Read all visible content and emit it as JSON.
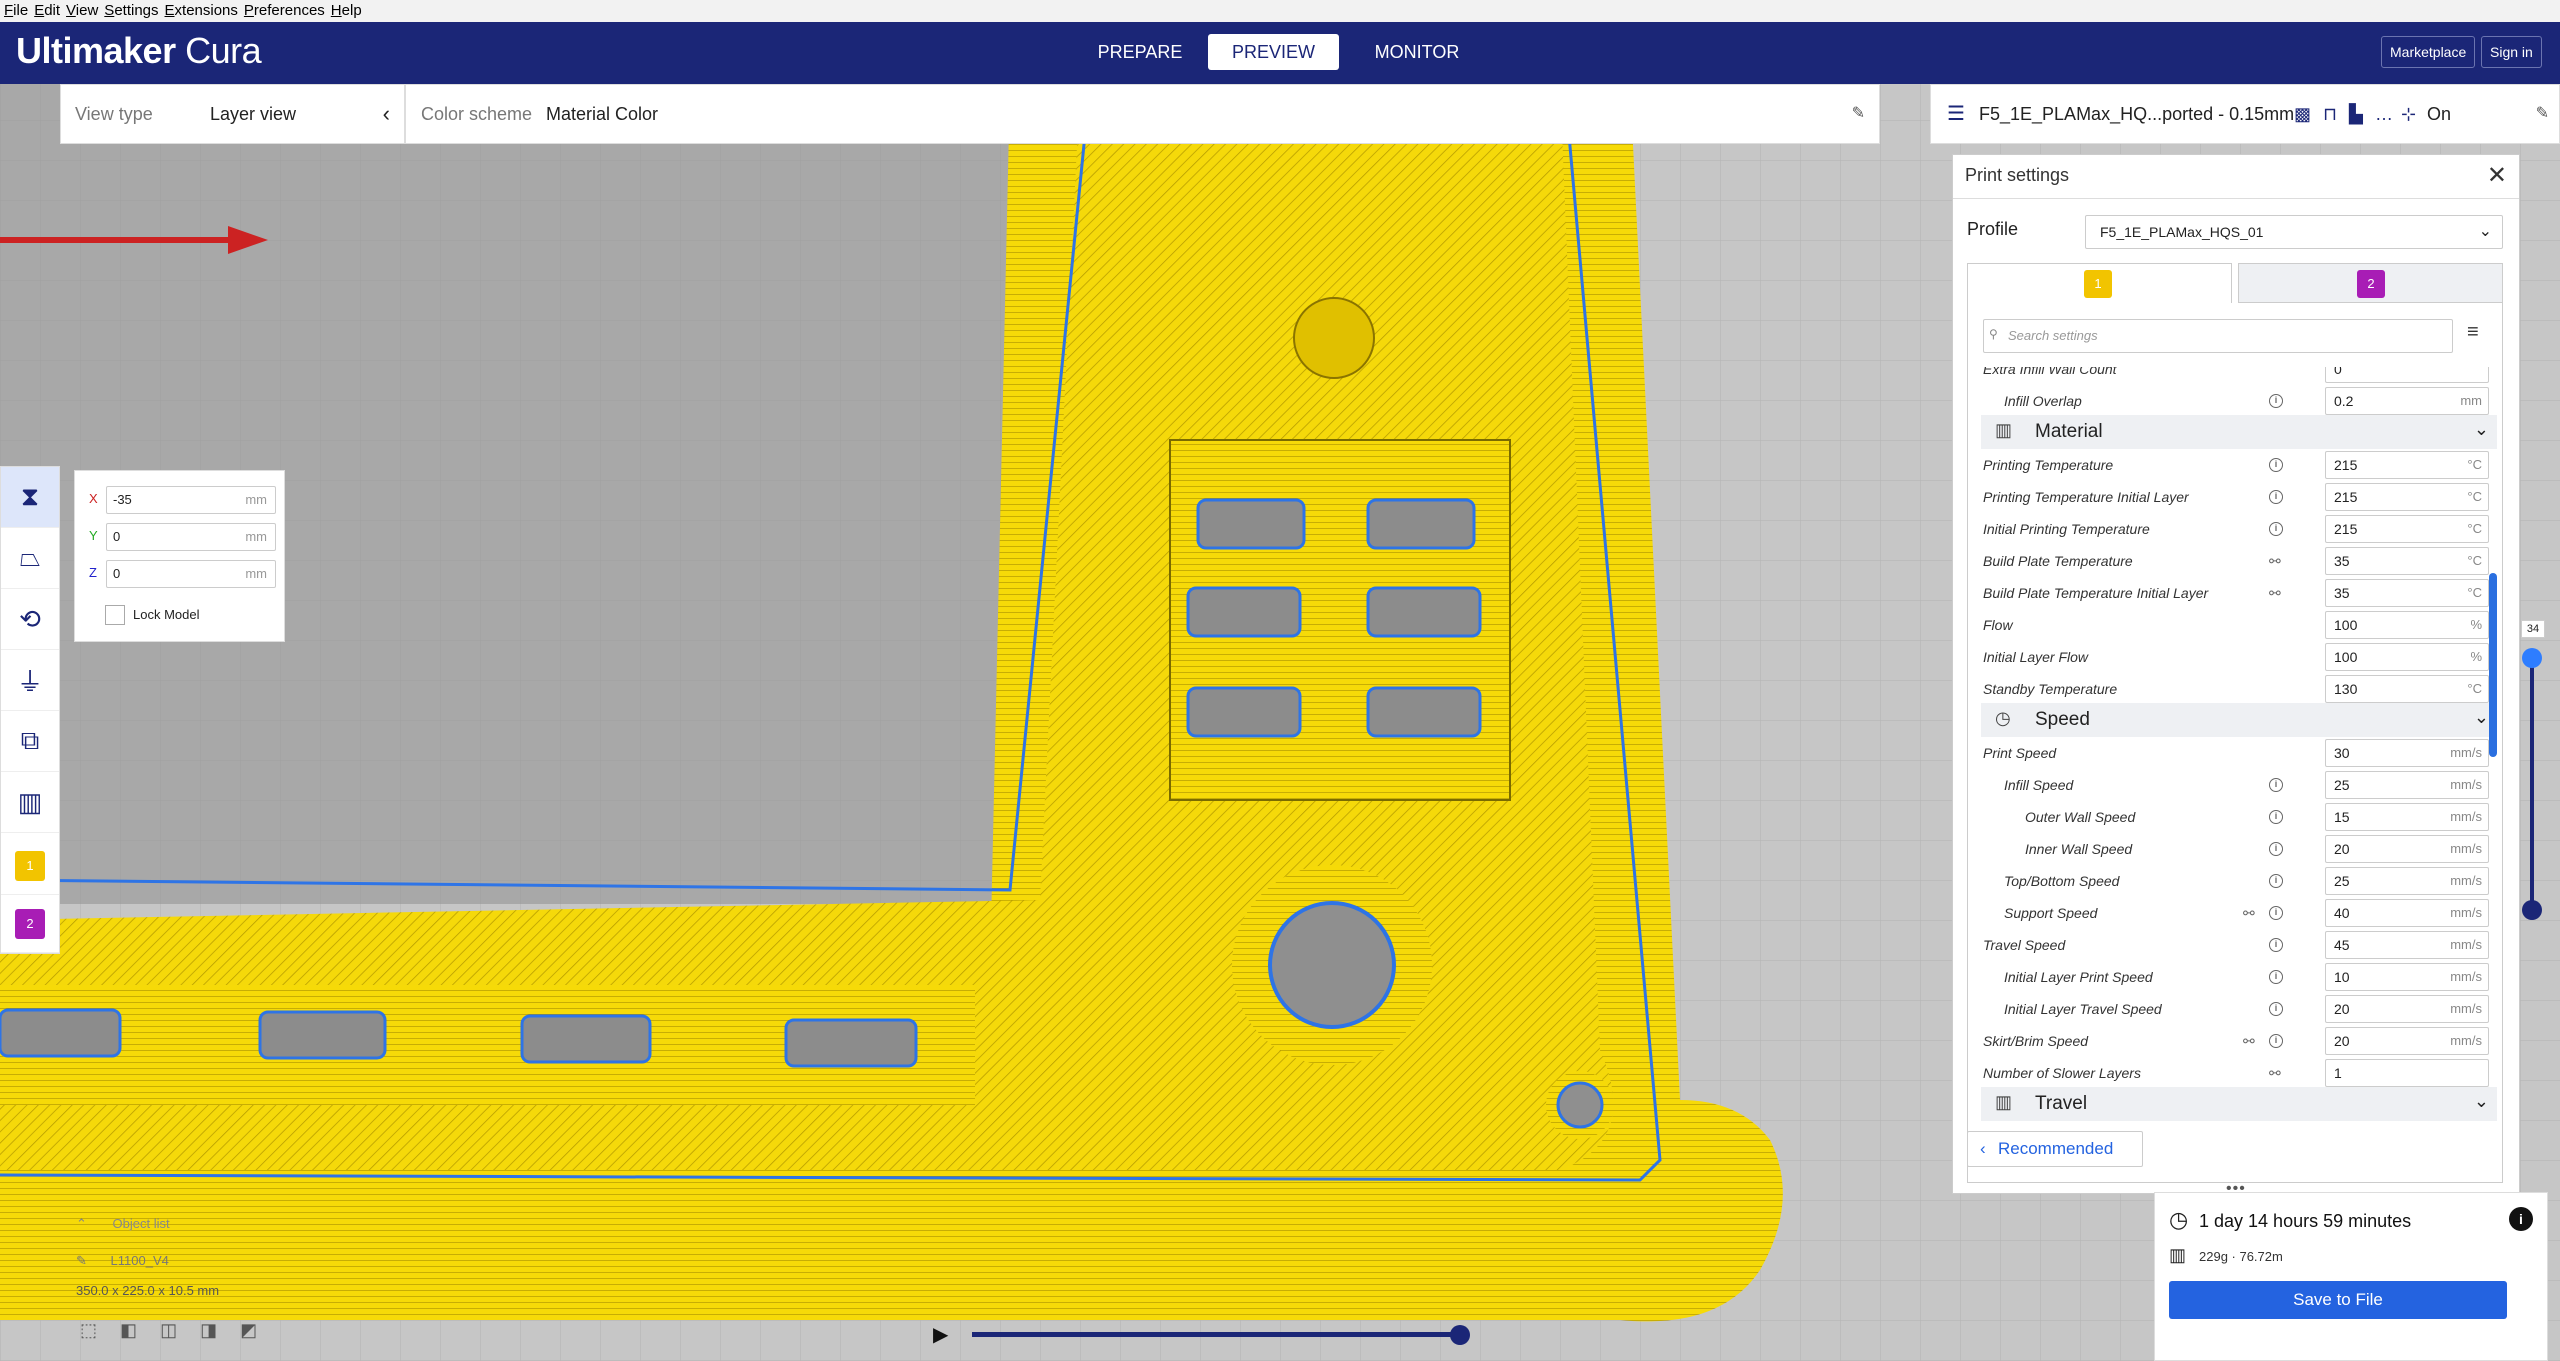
{
  "menu": [
    {
      "label": "File",
      "mn": "F",
      "rest": "ile"
    },
    {
      "label": "Edit",
      "mn": "E",
      "rest": "dit"
    },
    {
      "label": "View",
      "mn": "V",
      "rest": "iew"
    },
    {
      "label": "Settings",
      "mn": "S",
      "rest": "ettings"
    },
    {
      "label": "Extensions",
      "mn": "E",
      "rest": "xtensions"
    },
    {
      "label": "Preferences",
      "mn": "P",
      "rest": "references"
    },
    {
      "label": "Help",
      "mn": "H",
      "rest": "elp"
    }
  ],
  "header": {
    "brand_bold": "Ultimaker",
    "brand_light": "Cura",
    "stages": [
      "PREPARE",
      "PREVIEW",
      "MONITOR"
    ],
    "active_stage": "PREVIEW",
    "marketplace": "Marketplace",
    "sign_in": "Sign in"
  },
  "view_bar": {
    "view_type_label": "View type",
    "view_type_value": "Layer view",
    "color_scheme_label": "Color scheme",
    "color_scheme_value": "Material Color"
  },
  "profile_bar": {
    "profile_name": "F5_1E_PLAMax_HQ...ported - 0.15mm",
    "support_state": "On"
  },
  "move_panel": {
    "x": "-35",
    "y": "0",
    "z": "0",
    "unit": "mm",
    "lock_label": "Lock Model"
  },
  "extruders": [
    "1",
    "2"
  ],
  "print_settings": {
    "title": "Print settings",
    "profile_label": "Profile",
    "profile_value": "F5_1E_PLAMax_HQS_01",
    "search_placeholder": "Search settings",
    "partial_row": "Extra Infill Wall Count",
    "partial_value": "0",
    "rows": [
      {
        "label": "Infill Overlap",
        "value": "0.2",
        "unit": "mm",
        "indent": 1,
        "icons": "i"
      },
      {
        "category": "Material"
      },
      {
        "label": "Printing Temperature",
        "value": "215",
        "unit": "°C",
        "indent": 0,
        "icons": "i"
      },
      {
        "label": "Printing Temperature Initial Layer",
        "value": "215",
        "unit": "°C",
        "indent": 0,
        "icons": "i"
      },
      {
        "label": "Initial Printing Temperature",
        "value": "215",
        "unit": "°C",
        "indent": 0,
        "icons": "i"
      },
      {
        "label": "Build Plate Temperature",
        "value": "35",
        "unit": "°C",
        "indent": 0,
        "icons": "l"
      },
      {
        "label": "Build Plate Temperature Initial Layer",
        "value": "35",
        "unit": "°C",
        "indent": 0,
        "icons": "l"
      },
      {
        "label": "Flow",
        "value": "100",
        "unit": "%",
        "indent": 0,
        "icons": ""
      },
      {
        "label": "Initial Layer Flow",
        "value": "100",
        "unit": "%",
        "indent": 0,
        "icons": ""
      },
      {
        "label": "Standby Temperature",
        "value": "130",
        "unit": "°C",
        "indent": 0,
        "icons": ""
      },
      {
        "category": "Speed"
      },
      {
        "label": "Print Speed",
        "value": "30",
        "unit": "mm/s",
        "indent": 0,
        "icons": ""
      },
      {
        "label": "Infill Speed",
        "value": "25",
        "unit": "mm/s",
        "indent": 1,
        "icons": "i"
      },
      {
        "label": "Outer Wall Speed",
        "value": "15",
        "unit": "mm/s",
        "indent": 2,
        "icons": "i"
      },
      {
        "label": "Inner Wall Speed",
        "value": "20",
        "unit": "mm/s",
        "indent": 2,
        "icons": "i"
      },
      {
        "label": "Top/Bottom Speed",
        "value": "25",
        "unit": "mm/s",
        "indent": 1,
        "icons": "i"
      },
      {
        "label": "Support Speed",
        "value": "40",
        "unit": "mm/s",
        "indent": 1,
        "icons": "li"
      },
      {
        "label": "Travel Speed",
        "value": "45",
        "unit": "mm/s",
        "indent": 0,
        "icons": "i"
      },
      {
        "label": "Initial Layer Print Speed",
        "value": "10",
        "unit": "mm/s",
        "indent": 1,
        "icons": "i"
      },
      {
        "label": "Initial Layer Travel Speed",
        "value": "20",
        "unit": "mm/s",
        "indent": 1,
        "icons": "i"
      },
      {
        "label": "Skirt/Brim Speed",
        "value": "20",
        "unit": "mm/s",
        "indent": 0,
        "icons": "li"
      },
      {
        "label": "Number of Slower Layers",
        "value": "1",
        "unit": "",
        "indent": 0,
        "icons": "l"
      },
      {
        "category": "Travel"
      }
    ],
    "recommended_label": "Recommended"
  },
  "layer_slider": {
    "current_layer": "34"
  },
  "object_info": {
    "object_list_label": "Object list",
    "file_name": "L1100_V4",
    "dimensions": "350.0 x 225.0 x 10.5 mm"
  },
  "estimate": {
    "time": "1 day 14 hours 59 minutes",
    "material": "229g · 76.72m",
    "save_label": "Save to File"
  },
  "colors": {
    "header_bg": "#1b2677",
    "accent": "#2463e0",
    "filament": "#f2d400",
    "extruder1": "#f2c400",
    "extruder2": "#a81db5"
  }
}
